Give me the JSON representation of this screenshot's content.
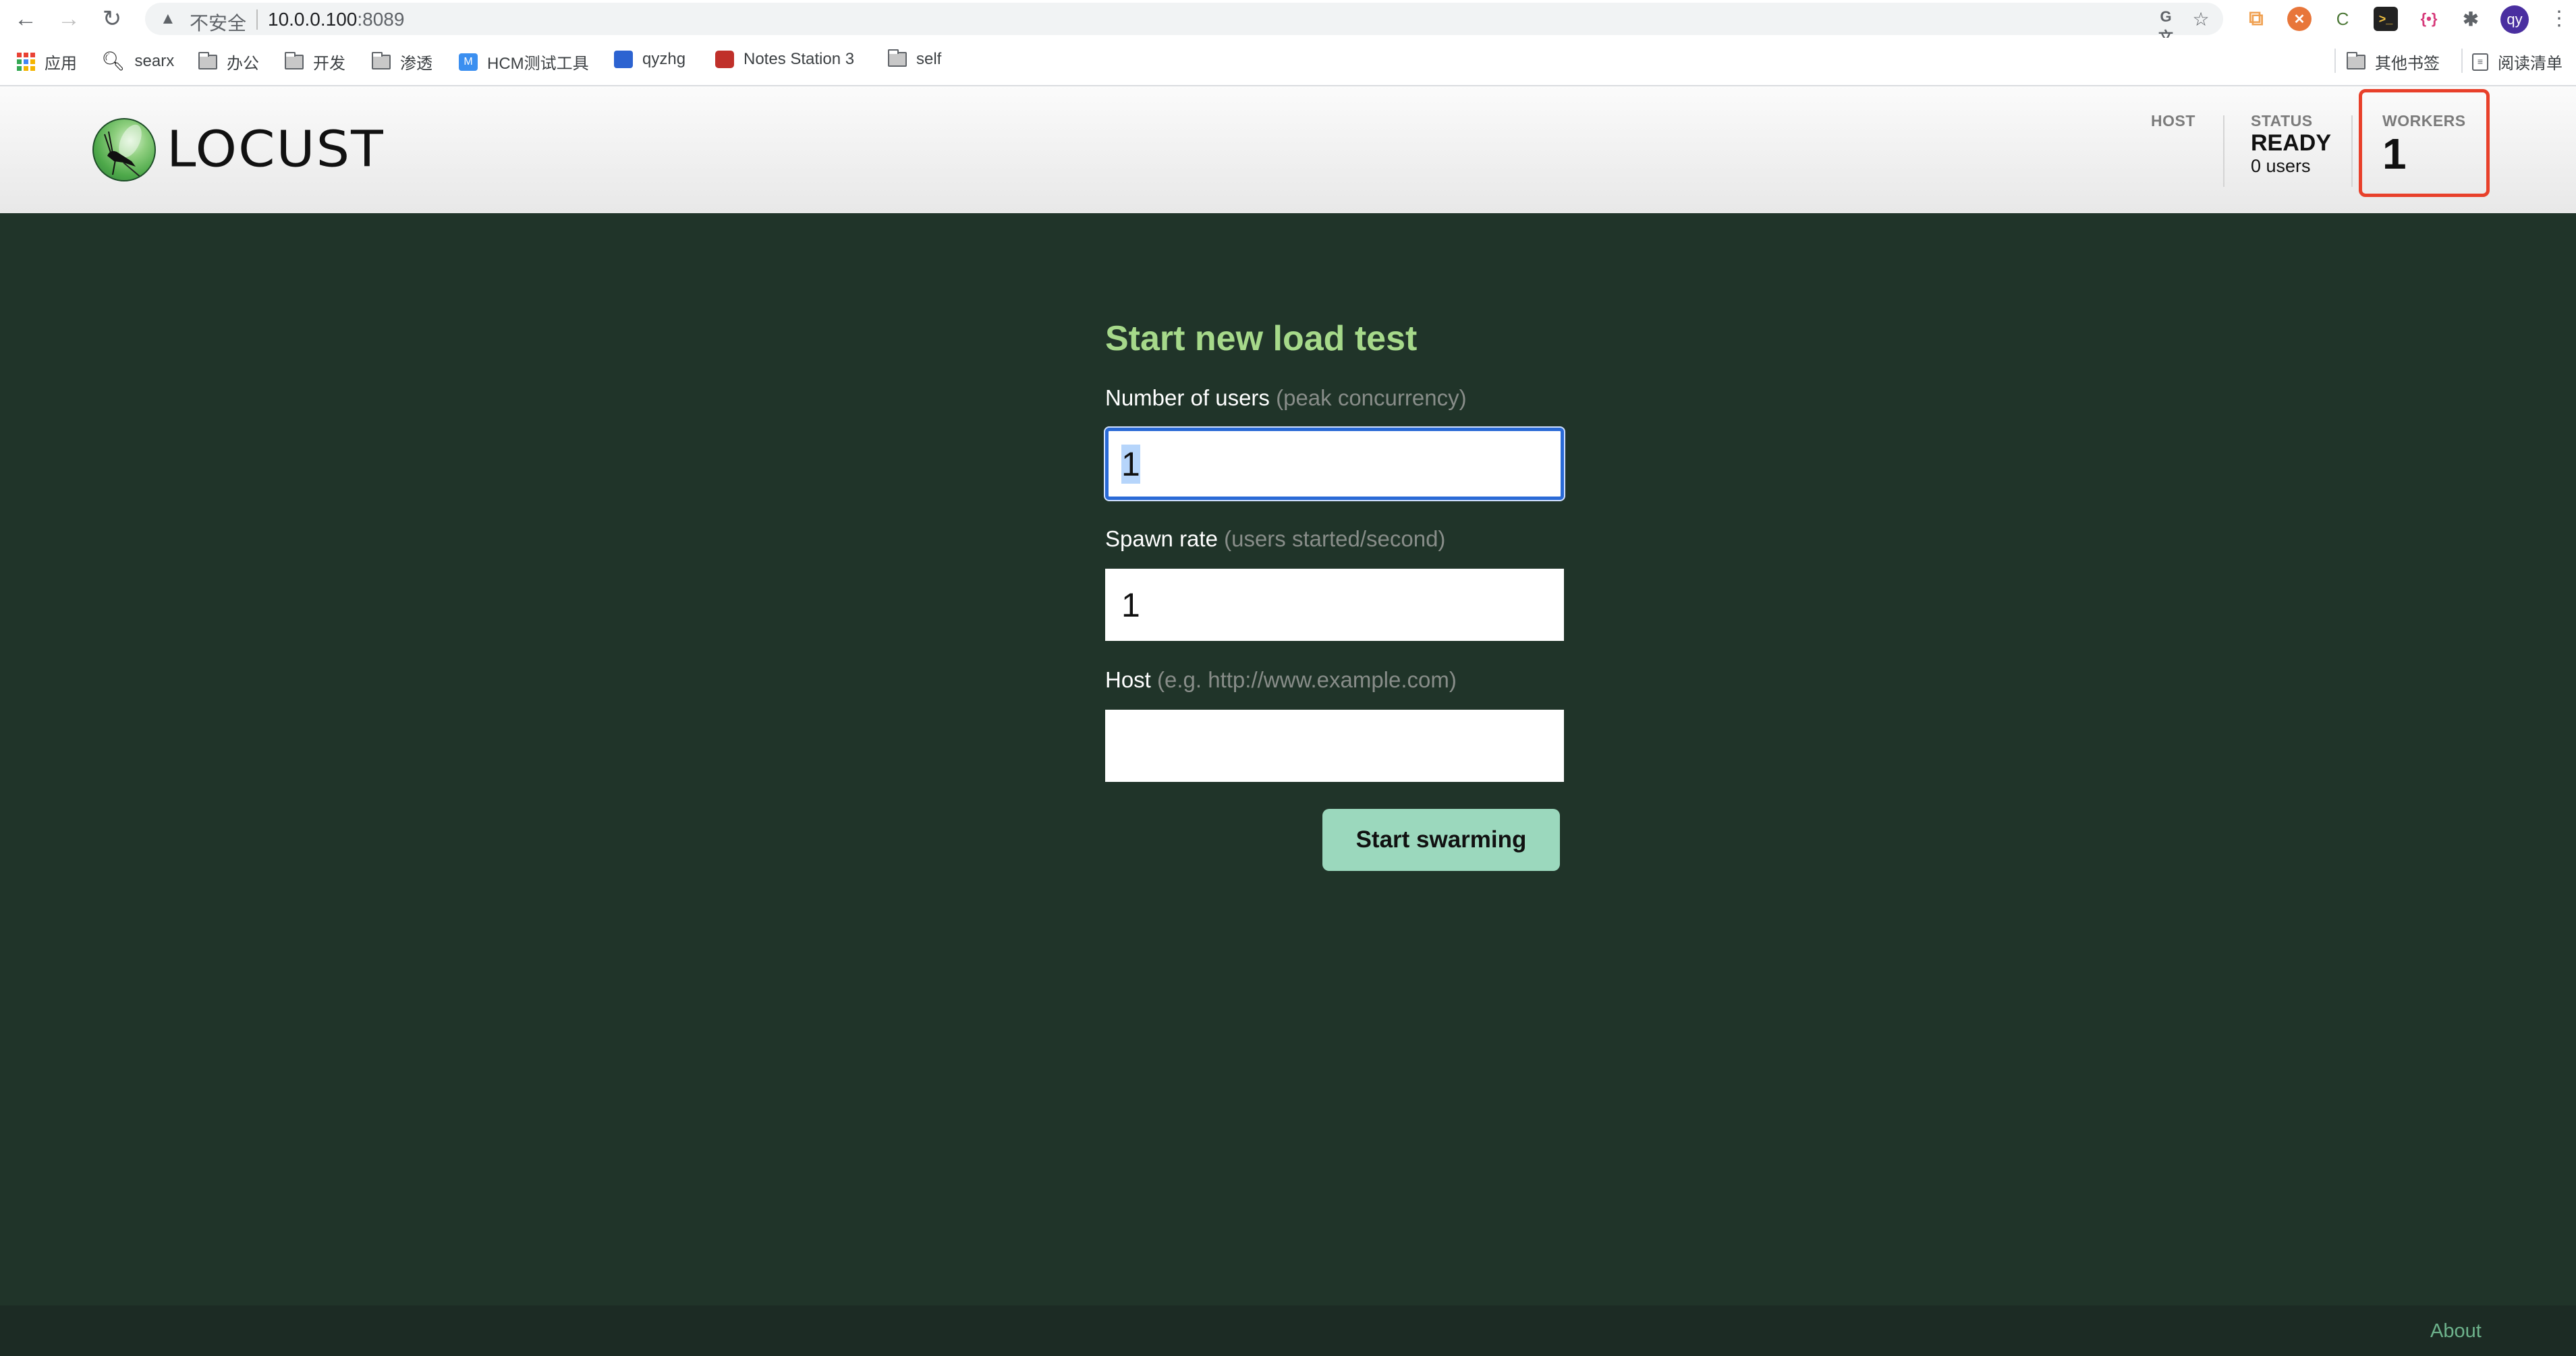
{
  "browser": {
    "back_icon": "arrow-left-icon",
    "forward_icon": "arrow-right-icon",
    "reload_icon": "reload-icon",
    "security_label": "不安全",
    "url_host": "10.0.0.100",
    "url_port": ":8089",
    "extensions": [
      {
        "name": "translate-icon",
        "glyph": "G文"
      },
      {
        "name": "star-icon",
        "glyph": "☆"
      },
      {
        "name": "copy-extension-icon",
        "glyph": "⧉",
        "color": "#f0a050"
      },
      {
        "name": "orange-extension-icon",
        "glyph": "✕",
        "color": "#e8763a"
      },
      {
        "name": "c-extension-icon",
        "glyph": "C",
        "color": "#4f7a3a"
      },
      {
        "name": "terminal-extension-icon",
        "glyph": ">_",
        "color": "#222222"
      },
      {
        "name": "json-extension-icon",
        "glyph": "{•}",
        "color": "#d63a7a"
      },
      {
        "name": "puzzle-icon",
        "glyph": "✱",
        "color": "#5f6368"
      }
    ],
    "profile_initials": "qy",
    "bookmarks": [
      {
        "label": "应用",
        "icon": "apps-icon"
      },
      {
        "label": "searx",
        "icon": "searx-icon"
      },
      {
        "label": "办公",
        "icon": "folder-icon"
      },
      {
        "label": "开发",
        "icon": "folder-icon"
      },
      {
        "label": "渗透",
        "icon": "folder-icon"
      },
      {
        "label": "HCM测试工具",
        "icon": "hcm-icon"
      },
      {
        "label": "qyzhg",
        "icon": "qyzhg-icon"
      },
      {
        "label": "Notes Station 3",
        "icon": "notes-icon"
      },
      {
        "label": "self",
        "icon": "folder-icon"
      }
    ],
    "other_bookmarks": "其他书签",
    "reading_list": "阅读清单"
  },
  "header": {
    "logo_text": "LOCUST",
    "host_label": "HOST",
    "host_value": "",
    "status_label": "STATUS",
    "status_value": "READY",
    "status_users": "0 users",
    "workers_label": "WORKERS",
    "workers_value": "1",
    "highlight_color": "#e8402a"
  },
  "form": {
    "title": "Start new load test",
    "users_label": "Number of users",
    "users_hint": "(peak concurrency)",
    "users_value": "1",
    "spawn_label": "Spawn rate",
    "spawn_hint": "(users started/second)",
    "spawn_value": "1",
    "host_label": "Host",
    "host_hint": "(e.g. http://www.example.com)",
    "host_value": "",
    "submit_label": "Start swarming"
  },
  "footer": {
    "about_label": "About"
  },
  "colors": {
    "background": "#203429",
    "title_green": "#a6d98a",
    "button_green": "#9bd8bd",
    "footer_link": "#6db38c"
  }
}
